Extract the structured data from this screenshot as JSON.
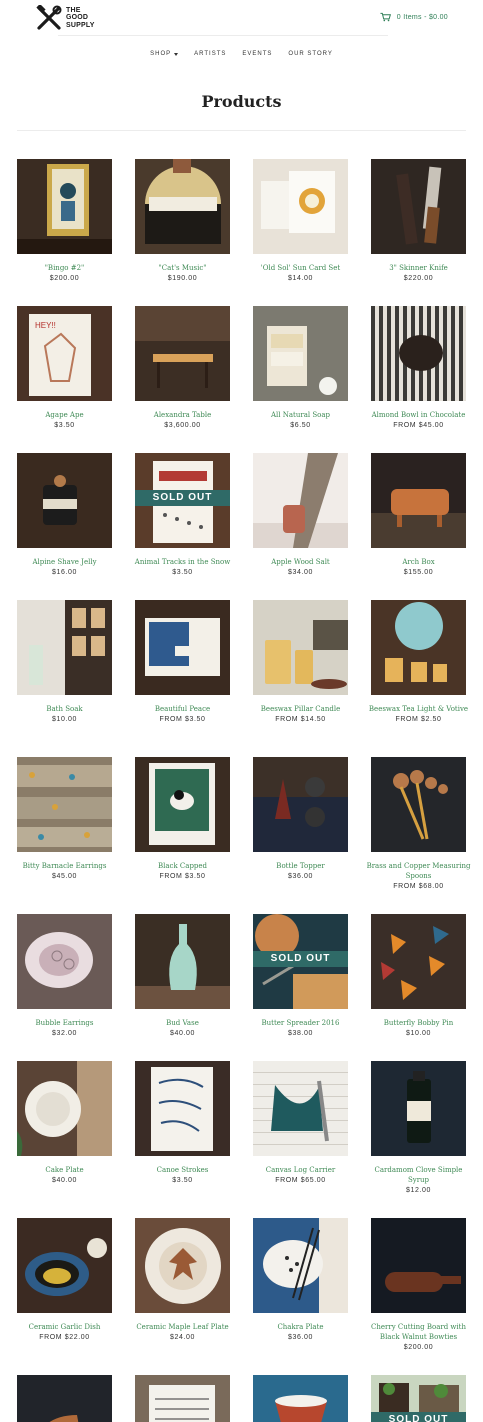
{
  "header": {
    "logo_lines": [
      "THE",
      "GOOD",
      "SUPPLY"
    ],
    "cart_text": "0 Items - $0.00",
    "cart_icon": "cart-icon",
    "accent_color": "#2f7f57"
  },
  "nav": {
    "items": [
      "SHOP",
      "ARTISTS",
      "EVENTS",
      "OUR STORY"
    ],
    "shop_icon": "chevron-down-icon"
  },
  "page": {
    "title": "Products"
  },
  "sold_out_label": "SOLD OUT",
  "products": [
    {
      "name": "\"Bingo #2\"",
      "price": "$200.00"
    },
    {
      "name": "\"Cat's Music\"",
      "price": "$190.00"
    },
    {
      "name": "'Old Sol' Sun Card Set",
      "price": "$14.00"
    },
    {
      "name": "3\" Skinner Knife",
      "price": "$220.00"
    },
    {
      "name": "Agape Ape",
      "price": "$3.50"
    },
    {
      "name": "Alexandra Table",
      "price": "$3,600.00"
    },
    {
      "name": "All Natural Soap",
      "price": "$6.50"
    },
    {
      "name": "Almond Bowl in Chocolate",
      "price": "FROM $45.00"
    },
    {
      "name": "Alpine Shave Jelly",
      "price": "$16.00"
    },
    {
      "name": "Animal Tracks in the Snow",
      "price": "$3.50",
      "sold_out": true
    },
    {
      "name": "Apple Wood Salt",
      "price": "$34.00"
    },
    {
      "name": "Arch Box",
      "price": "$155.00"
    },
    {
      "name": "Bath Soak",
      "price": "$10.00"
    },
    {
      "name": "Beautiful Peace",
      "price": "FROM $3.50"
    },
    {
      "name": "Beeswax Pillar Candle",
      "price": "FROM $14.50"
    },
    {
      "name": "Beeswax Tea Light & Votive",
      "price": "FROM $2.50"
    },
    {
      "name": "Bitty Barnacle Earrings",
      "price": "$45.00"
    },
    {
      "name": "Black Capped",
      "price": "FROM $3.50"
    },
    {
      "name": "Bottle Topper",
      "price": "$36.00"
    },
    {
      "name": "Brass and Copper Measuring Spoons",
      "price": "FROM $68.00"
    },
    {
      "name": "Bubble Earrings",
      "price": "$32.00"
    },
    {
      "name": "Bud Vase",
      "price": "$40.00"
    },
    {
      "name": "Butter Spreader 2016",
      "price": "$38.00",
      "sold_out": true
    },
    {
      "name": "Butterfly Bobby Pin",
      "price": "$10.00"
    },
    {
      "name": "Cake Plate",
      "price": "$40.00"
    },
    {
      "name": "Canoe Strokes",
      "price": "$3.50"
    },
    {
      "name": "Canvas Log Carrier",
      "price": "FROM $65.00"
    },
    {
      "name": "Cardamom Clove Simple Syrup",
      "price": "$12.00"
    },
    {
      "name": "Ceramic Garlic Dish",
      "price": "FROM $22.00"
    },
    {
      "name": "Ceramic Maple Leaf Plate",
      "price": "$24.00"
    },
    {
      "name": "Chakra Plate",
      "price": "$36.00"
    },
    {
      "name": "Cherry Cutting Board with Black Walnut Bowties",
      "price": "$200.00"
    },
    {
      "name": "",
      "price": ""
    },
    {
      "name": "",
      "price": ""
    },
    {
      "name": "",
      "price": ""
    },
    {
      "name": "",
      "price": "",
      "sold_out": true
    }
  ]
}
